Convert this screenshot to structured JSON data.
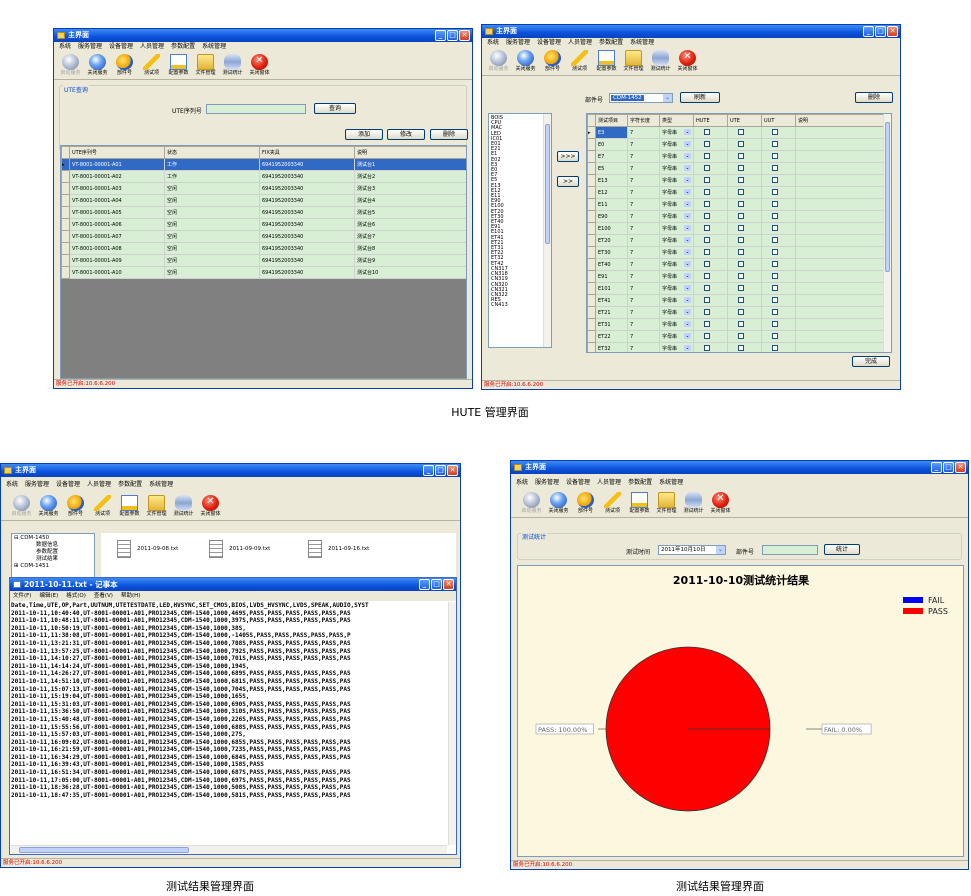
{
  "app": {
    "title": "主界面",
    "menu": [
      "系统",
      "服务管理",
      "设备管理",
      "人员管理",
      "参数配置",
      "系统管理"
    ],
    "toolbar": [
      {
        "label": "启动服务",
        "icon": "start-service-icon",
        "enabled": false
      },
      {
        "label": "关闭服务",
        "icon": "stop-service-icon",
        "enabled": true
      },
      {
        "label": "部件号",
        "icon": "part-number-icon",
        "enabled": true
      },
      {
        "label": "测试项",
        "icon": "test-item-icon",
        "enabled": true
      },
      {
        "label": "配置参数",
        "icon": "config-params-icon",
        "enabled": true
      },
      {
        "label": "文件管理",
        "icon": "file-manage-icon",
        "enabled": true
      },
      {
        "label": "测试统计",
        "icon": "test-stats-icon",
        "enabled": true
      },
      {
        "label": "关闭窗体",
        "icon": "close-form-icon",
        "enabled": true
      }
    ],
    "status": "服务已开启:10.6.6.200"
  },
  "captions": {
    "top": "HUTE 管理界面",
    "bottom_left": "测试结果管理界面",
    "bottom_right": "测试结果管理界面"
  },
  "w1": {
    "group_title": "UTE查询",
    "field_label": "UTE序列号",
    "search_btn": "查询",
    "add_btn": "添加",
    "edit_btn": "修改",
    "delete_btn": "删除",
    "columns": [
      "UTE序列号",
      "状态",
      "FIX夹具",
      "说明"
    ],
    "rows": [
      [
        "VT-8001-00001-A01",
        "工作",
        "6941952003340",
        "测试台1"
      ],
      [
        "VT-8001-00001-A02",
        "工作",
        "6941952003340",
        "测试台2"
      ],
      [
        "VT-8001-00001-A03",
        "空闲",
        "6941952003340",
        "测试台3"
      ],
      [
        "VT-8001-00001-A04",
        "空闲",
        "6941952003340",
        "测试台4"
      ],
      [
        "VT-8001-00001-A05",
        "空闲",
        "6941952003340",
        "测试台5"
      ],
      [
        "VT-8001-00001-A06",
        "空闲",
        "6941952003340",
        "测试台6"
      ],
      [
        "VT-8001-00001-A07",
        "空闲",
        "6941952003340",
        "测试台7"
      ],
      [
        "VT-8001-00001-A08",
        "空闲",
        "6941952003340",
        "测试台8"
      ],
      [
        "VT-8001-00001-A09",
        "空闲",
        "6941952003340",
        "测试台9"
      ],
      [
        "VT-8001-00001-A10",
        "空闲",
        "6941952003340",
        "测试台10"
      ]
    ]
  },
  "w2": {
    "part_label": "部件号",
    "part_value": "CDM-1452",
    "refresh_btn": "刷新",
    "delete_btn": "删除",
    "done_btn": "完成",
    "move_btn_1": ">>>",
    "move_btn_2": ">>",
    "list_items": [
      "BOIS",
      "CPU",
      "MAC",
      "LED",
      "IC01",
      "E01",
      "E21",
      "E1",
      "E02",
      "E3",
      "E0",
      "E7",
      "E5",
      "E13",
      "E12",
      "E11",
      "E90",
      "E100",
      "ET20",
      "ET30",
      "ET40",
      "E91",
      "E101",
      "ET41",
      "ET21",
      "ET31",
      "ET22",
      "ET32",
      "ET42",
      "CN317",
      "CN318",
      "CN319",
      "CN320",
      "CN321",
      "CN322",
      "RES",
      "CN413"
    ],
    "columns": [
      "测试项目",
      "字符长度",
      "类型",
      "HUTE",
      "UTE",
      "UUT",
      "说明"
    ],
    "type_value": "字母串",
    "length_value": "7",
    "rows": [
      "E3",
      "E0",
      "E7",
      "E5",
      "E13",
      "E12",
      "E11",
      "E90",
      "E100",
      "ET20",
      "ET30",
      "ET40",
      "E91",
      "E101",
      "ET41",
      "ET21",
      "ET31",
      "ET22",
      "ET32"
    ]
  },
  "w3": {
    "tree": [
      "CDM-1450",
      "数据信息",
      "参数配置",
      "测试结果",
      "CDM-1451"
    ],
    "files": [
      "2011-09-08.txt",
      "2011-09-09.txt",
      "2011-09-16.txt"
    ],
    "notepad_title": "2011-10-11.txt - 记事本",
    "notepad_menu": [
      "文件(F)",
      "编辑(E)",
      "格式(O)",
      "查看(V)",
      "帮助(H)"
    ],
    "lines": [
      "Date,Time,UTE,OP,Part,UUTNUM,UTETESTDATE,LED,HVSYNC,SET_CMOS,BIOS,LVDS_HVSYNC,LVDS,SPEAK,AUDIO,SYST",
      "2011-10-11,10:40:40,UT-8001-00001-A01,PRO12345,CDM-1540,1000,469S,PASS,PASS,PASS,PASS,PASS,PAS",
      "2011-10-11,10:48:11,UT-8001-00001-A01,PRO12345,CDM-1540,1000,397S,PASS,PASS,PASS,PASS,PASS,PAS",
      "2011-10-11,10:50:19,UT-8001-00001-A01,PRO12345,CDM-1540,1000,38S,",
      "2011-10-11,11:38:08,UT-8001-00001-A01,PRO12345,CDM-1540,1000,-1405S,PASS,PASS,PASS,PASS,PASS,P",
      "2011-10-11,13:21:31,UT-8001-00001-A01,PRO12345,CDM-1540,1000,708S,PASS,PASS,PASS,PASS,PASS,PAS",
      "2011-10-11,13:57:25,UT-8001-00001-A01,PRO12345,CDM-1540,1000,792S,PASS,PASS,PASS,PASS,PASS,PAS",
      "2011-10-11,14:10:27,UT-8001-00001-A01,PRO12345,CDM-1540,1000,701S,PASS,PASS,PASS,PASS,PASS,PAS",
      "2011-10-11,14:14:24,UT-8001-00001-A01,PRO12345,CDM-1540,1000,194S,",
      "2011-10-11,14:26:27,UT-8001-00001-A01,PRO12345,CDM-1540,1000,689S,PASS,PASS,PASS,PASS,PASS,PAS",
      "2011-10-11,14:51:10,UT-8001-00001-A01,PRO12345,CDM-1540,1000,681S,PASS,PASS,PASS,PASS,PASS,PAS",
      "2011-10-11,15:07:13,UT-8001-00001-A01,PRO12345,CDM-1540,1000,704S,PASS,PASS,PASS,PASS,PASS,PAS",
      "2011-10-11,15:19:04,UT-8001-00001-A01,PRO12345,CDM-1540,1000,165S,",
      "2011-10-11,15:31:03,UT-8001-00001-A01,PRO12345,CDM-1540,1000,690S,PASS,PASS,PASS,PASS,PASS,PAS",
      "2011-10-11,15:36:50,UT-8001-00001-A01,PRO12345,CDM-1540,1000,310S,PASS,PASS,PASS,PASS,PASS,PAS",
      "2011-10-11,15:40:48,UT-8001-00001-A01,PRO12345,CDM-1540,1000,226S,PASS,PASS,PASS,PASS,PASS,PAS",
      "2011-10-11,15:55:56,UT-8001-00001-A01,PRO12345,CDM-1540,1000,688S,PASS,PASS,PASS,PASS,PASS,PAS",
      "2011-10-11,15:57:03,UT-8001-00001-A01,PRO12345,CDM-1540,1000,27S,",
      "2011-10-11,16:09:02,UT-8001-00001-A01,PRO12345,CDM-1540,1000,685S,PASS,PASS,PASS,PASS,PASS,PAS",
      "2011-10-11,16:21:59,UT-8001-00001-A01,PRO12345,CDM-1540,1000,723S,PASS,PASS,PASS,PASS,PASS,PAS",
      "2011-10-11,16:34:29,UT-8001-00001-A01,PRO12345,CDM-1540,1000,684S,PASS,PASS,PASS,PASS,PASS,PAS",
      "2011-10-11,16:39:43,UT-8001-00001-A01,PRO12345,CDM-1540,1000,158S,PASS",
      "2011-10-11,16:51:34,UT-8001-00001-A01,PRO12345,CDM-1540,1000,687S,PASS,PASS,PASS,PASS,PASS,PAS",
      "2011-10-11,17:05:00,UT-8001-00001-A01,PRO12345,CDM-1540,1000,697S,PASS,PASS,PASS,PASS,PASS,PAS",
      "2011-10-11,18:36:28,UT-8001-00001-A01,PRO12345,CDM-1540,1000,508S,PASS,PASS,PASS,PASS,PASS,PAS",
      "2011-10-11,18:47:35,UT-8001-00001-A01,PRO12345,CDM-1540,1000,581S,PASS,PASS,PASS,PASS,PASS,PAS"
    ]
  },
  "w4": {
    "group_title": "测试统计",
    "time_label": "测试时间",
    "time_value": "2011年10月10日",
    "part_label": "部件号",
    "stat_btn": "统计"
  },
  "chart_data": {
    "type": "pie",
    "title": "2011-10-10测试统计结果",
    "categories": [
      "FAIL",
      "PASS"
    ],
    "values": [
      0,
      100
    ],
    "labels": [
      "FAIL: 0.00%",
      "PASS: 100.00%"
    ],
    "colors": [
      "#0000ff",
      "#ff0000"
    ],
    "legend": "top-right"
  }
}
